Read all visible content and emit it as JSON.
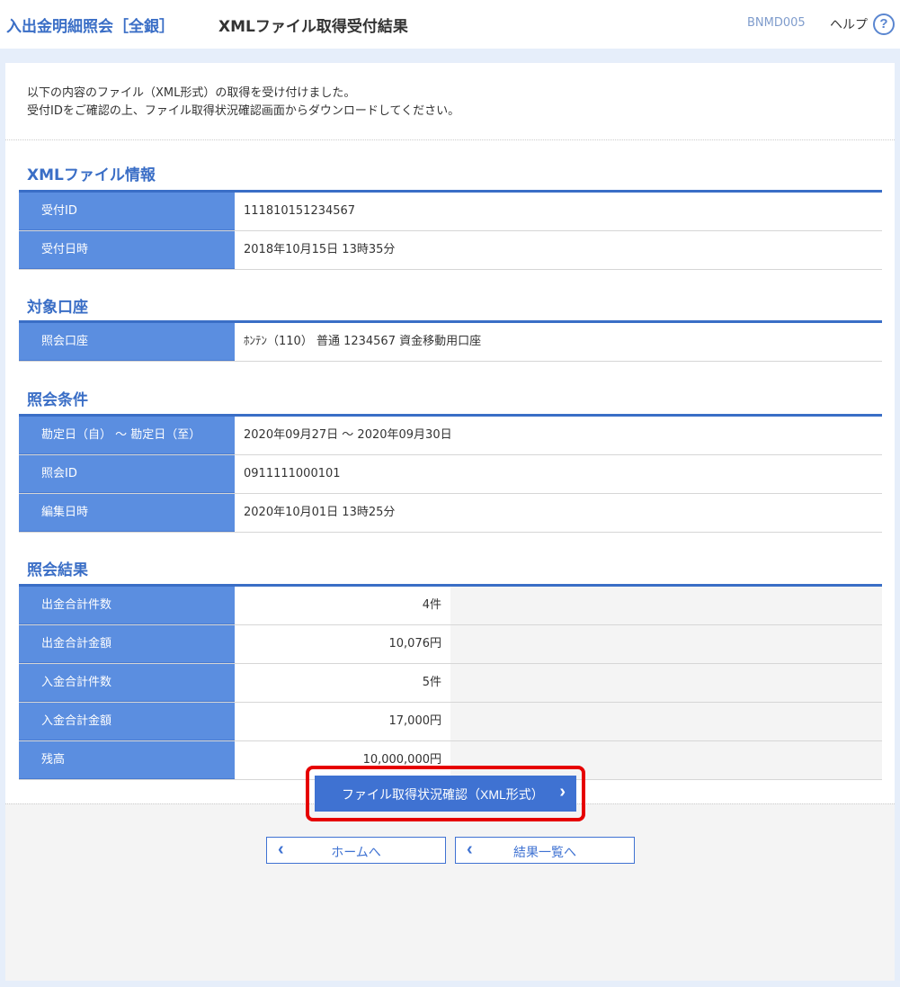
{
  "header": {
    "app_title": "入出金明細照会［全銀］",
    "page_title": "XMLファイル取得受付結果",
    "screen_code": "BNMD005",
    "help_label": "ヘルプ",
    "help_icon": "?"
  },
  "intro": {
    "line1": "以下の内容のファイル（XML形式）の取得を受け付けました。",
    "line2": "受付IDをご確認の上、ファイル取得状況確認画面からダウンロードしてください。"
  },
  "xml_info": {
    "title": "XMLファイル情報",
    "rows": [
      {
        "label": "受付ID",
        "value": "111810151234567"
      },
      {
        "label": "受付日時",
        "value": "2018年10月15日 13時35分"
      }
    ]
  },
  "account": {
    "title": "対象口座",
    "rows": [
      {
        "label": "照会口座",
        "value": "ﾎﾝﾃﾝ（110） 普通 1234567 資金移動用口座"
      }
    ]
  },
  "conditions": {
    "title": "照会条件",
    "rows": [
      {
        "label": "勘定日（自） ～ 勘定日（至）",
        "value": "2020年09月27日 ～ 2020年09月30日"
      },
      {
        "label": "照会ID",
        "value": "0911111000101"
      },
      {
        "label": "編集日時",
        "value": "2020年10月01日 13時25分"
      }
    ]
  },
  "results": {
    "title": "照会結果",
    "rows": [
      {
        "label": "出金合計件数",
        "value": "4件"
      },
      {
        "label": "出金合計金額",
        "value": "10,076円"
      },
      {
        "label": "入金合計件数",
        "value": "5件"
      },
      {
        "label": "入金合計金額",
        "value": "17,000円"
      },
      {
        "label": "残高",
        "value": "10,000,000円"
      }
    ]
  },
  "buttons": {
    "primary": "ファイル取得状況確認（XML形式）",
    "home": "ホームへ",
    "result_list": "結果一覧へ"
  },
  "colors": {
    "accent": "#3a6ec6",
    "header_cell": "#5b8ee0",
    "highlight": "#e60000"
  }
}
